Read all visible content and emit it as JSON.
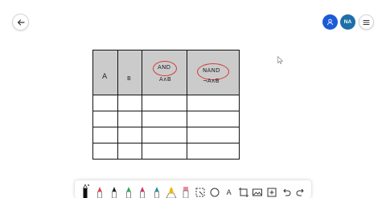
{
  "header": {
    "back_icon": "arrow-left-icon",
    "share_icon": "person-icon",
    "avatar_initials": "NA",
    "menu_icon": "hamburger-icon",
    "accent_color": "#1c5bd6",
    "avatar_color": "#1f6fa8"
  },
  "table": {
    "header_bg": "#cbcbcb",
    "columns": [
      {
        "label": "A"
      },
      {
        "label": "B"
      },
      {
        "label": "AND",
        "circled": true,
        "expression": "A∧B"
      },
      {
        "label": "NAND",
        "circled": true,
        "expression": "¬A∧B"
      }
    ],
    "empty_rows": 4,
    "circle_color": "#d23a3a"
  },
  "toolbar": {
    "tools": [
      "pen-icon",
      "red-marker-icon",
      "black-marker-icon",
      "green-marker-icon",
      "blue-marker-icon",
      "teal-marker-icon",
      "yellow-highlighter-icon",
      "eraser-icon",
      "lasso-icon",
      "shapes-icon",
      "text-icon",
      "crop-icon",
      "image-icon",
      "add-box-icon",
      "undo-icon",
      "redo-icon"
    ],
    "text_tool_label": "A"
  }
}
